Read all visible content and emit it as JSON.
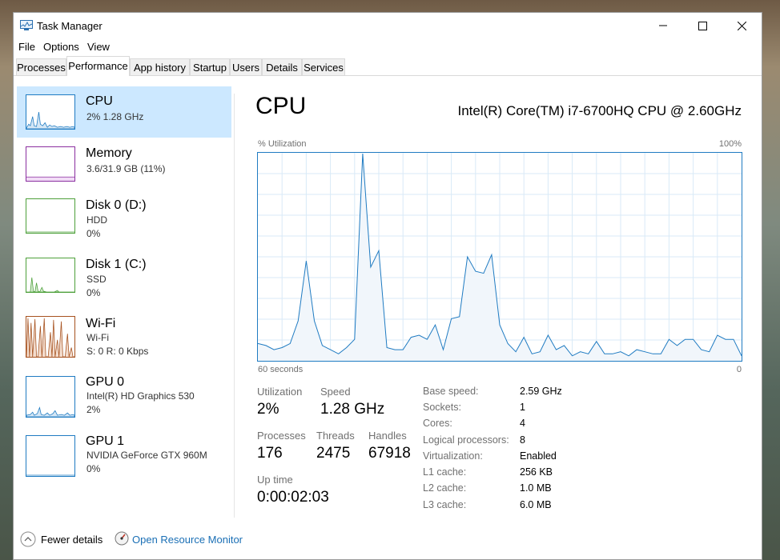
{
  "window": {
    "title": "Task Manager"
  },
  "menu": [
    "File",
    "Options",
    "View"
  ],
  "tabs": [
    "Processes",
    "Performance",
    "App history",
    "Startup",
    "Users",
    "Details",
    "Services"
  ],
  "sidebar": [
    {
      "name": "CPU",
      "sub1": "2%  1.28 GHz",
      "sub2": "",
      "sub3": "",
      "color": "#1f7bc2"
    },
    {
      "name": "Memory",
      "sub1": "3.6/31.9 GB (11%)",
      "sub2": "",
      "sub3": "",
      "color": "#8b2fa0"
    },
    {
      "name": "Disk 0 (D:)",
      "sub1": "HDD",
      "sub2": "0%",
      "sub3": "",
      "color": "#4da03a"
    },
    {
      "name": "Disk 1 (C:)",
      "sub1": "SSD",
      "sub2": "0%",
      "sub3": "",
      "color": "#4da03a"
    },
    {
      "name": "Wi-Fi",
      "sub1": "Wi-Fi",
      "sub2": "S: 0  R: 0 Kbps",
      "sub3": "",
      "color": "#a7521f"
    },
    {
      "name": "GPU 0",
      "sub1": "Intel(R) HD Graphics 530",
      "sub2": "2%",
      "sub3": "",
      "color": "#1f7bc2"
    },
    {
      "name": "GPU 1",
      "sub1": "NVIDIA GeForce GTX 960M",
      "sub2": "0%",
      "sub3": "",
      "color": "#1f7bc2"
    }
  ],
  "main": {
    "title": "CPU",
    "model": "Intel(R) Core(TM) i7-6700HQ CPU @ 2.60GHz",
    "util_label": "% Utilization",
    "max_label": "100%",
    "time_label": "60 seconds",
    "zero_label": "0"
  },
  "stats": {
    "utilization_label": "Utilization",
    "utilization": "2%",
    "speed_label": "Speed",
    "speed": "1.28 GHz",
    "processes_label": "Processes",
    "processes": "176",
    "threads_label": "Threads",
    "threads": "2475",
    "handles_label": "Handles",
    "handles": "67918",
    "uptime_label": "Up time",
    "uptime": "0:00:02:03"
  },
  "details": [
    {
      "label": "Base speed:",
      "value": "2.59 GHz"
    },
    {
      "label": "Sockets:",
      "value": "1"
    },
    {
      "label": "Cores:",
      "value": "4"
    },
    {
      "label": "Logical processors:",
      "value": "8"
    },
    {
      "label": "Virtualization:",
      "value": "Enabled"
    },
    {
      "label": "L1 cache:",
      "value": "256 KB"
    },
    {
      "label": "L2 cache:",
      "value": "1.0 MB"
    },
    {
      "label": "L3 cache:",
      "value": "6.0 MB"
    }
  ],
  "footer": {
    "fewer": "Fewer details",
    "resource": "Open Resource Monitor"
  },
  "chart_data": {
    "type": "area",
    "ylabel": "% Utilization",
    "ylim": [
      0,
      100
    ],
    "x_label": "60 seconds",
    "values": [
      8,
      7,
      5,
      6,
      8,
      19,
      48,
      19,
      7,
      5,
      3,
      6,
      10,
      100,
      45,
      53,
      6,
      5,
      5,
      11,
      12,
      10,
      17,
      5,
      20,
      21,
      50,
      43,
      42,
      51,
      17,
      8,
      4,
      11,
      3,
      4,
      12,
      5,
      7,
      2,
      4,
      3,
      9,
      3,
      3,
      4,
      2,
      5,
      4,
      3,
      3,
      10,
      7,
      10,
      10,
      5,
      4,
      12,
      10,
      10,
      2
    ]
  },
  "colors": {
    "accent": "#1f7bc2",
    "selected": "#cce8ff"
  }
}
